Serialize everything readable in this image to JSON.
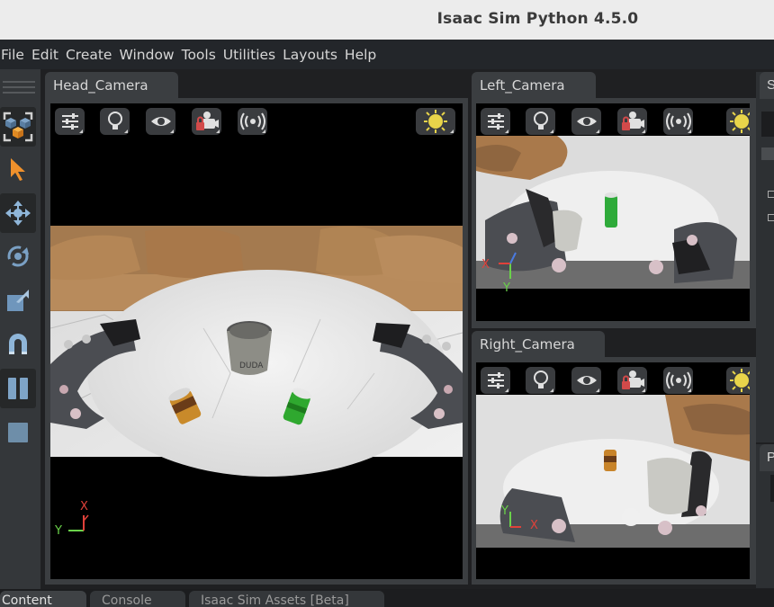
{
  "window": {
    "title": "Isaac Sim Python 4.5.0"
  },
  "menu": [
    "File",
    "Edit",
    "Create",
    "Window",
    "Tools",
    "Utilities",
    "Layouts",
    "Help"
  ],
  "viewports": {
    "head": {
      "tab": "Head_Camera"
    },
    "left": {
      "tab": "Left_Camera"
    },
    "right": {
      "tab": "Right_Camera"
    }
  },
  "axes": {
    "x": "X",
    "y": "Y"
  },
  "bottom_tabs": [
    "Content",
    "Console",
    "Isaac Sim Assets [Beta]"
  ],
  "right_panel": {
    "tab_top": "S",
    "tab_bottom": "P"
  },
  "icons": {
    "viewport_toolbar": [
      "settings-sliders-icon",
      "lightbulb-icon",
      "eye-icon",
      "camera-lock-icon",
      "broadcast-icon"
    ],
    "viewport_right": "sun-icon",
    "tools": [
      "select-mode-icon",
      "pointer-arrow-icon",
      "move-icon",
      "rotate-icon",
      "scale-icon",
      "snap-magnet-icon",
      "pause-icon",
      "stop-icon"
    ]
  },
  "colors": {
    "accent_orange": "#f0912c",
    "axis_x": "#e0413a",
    "axis_y": "#6ad24a",
    "sun_yellow": "#e8d44a"
  }
}
